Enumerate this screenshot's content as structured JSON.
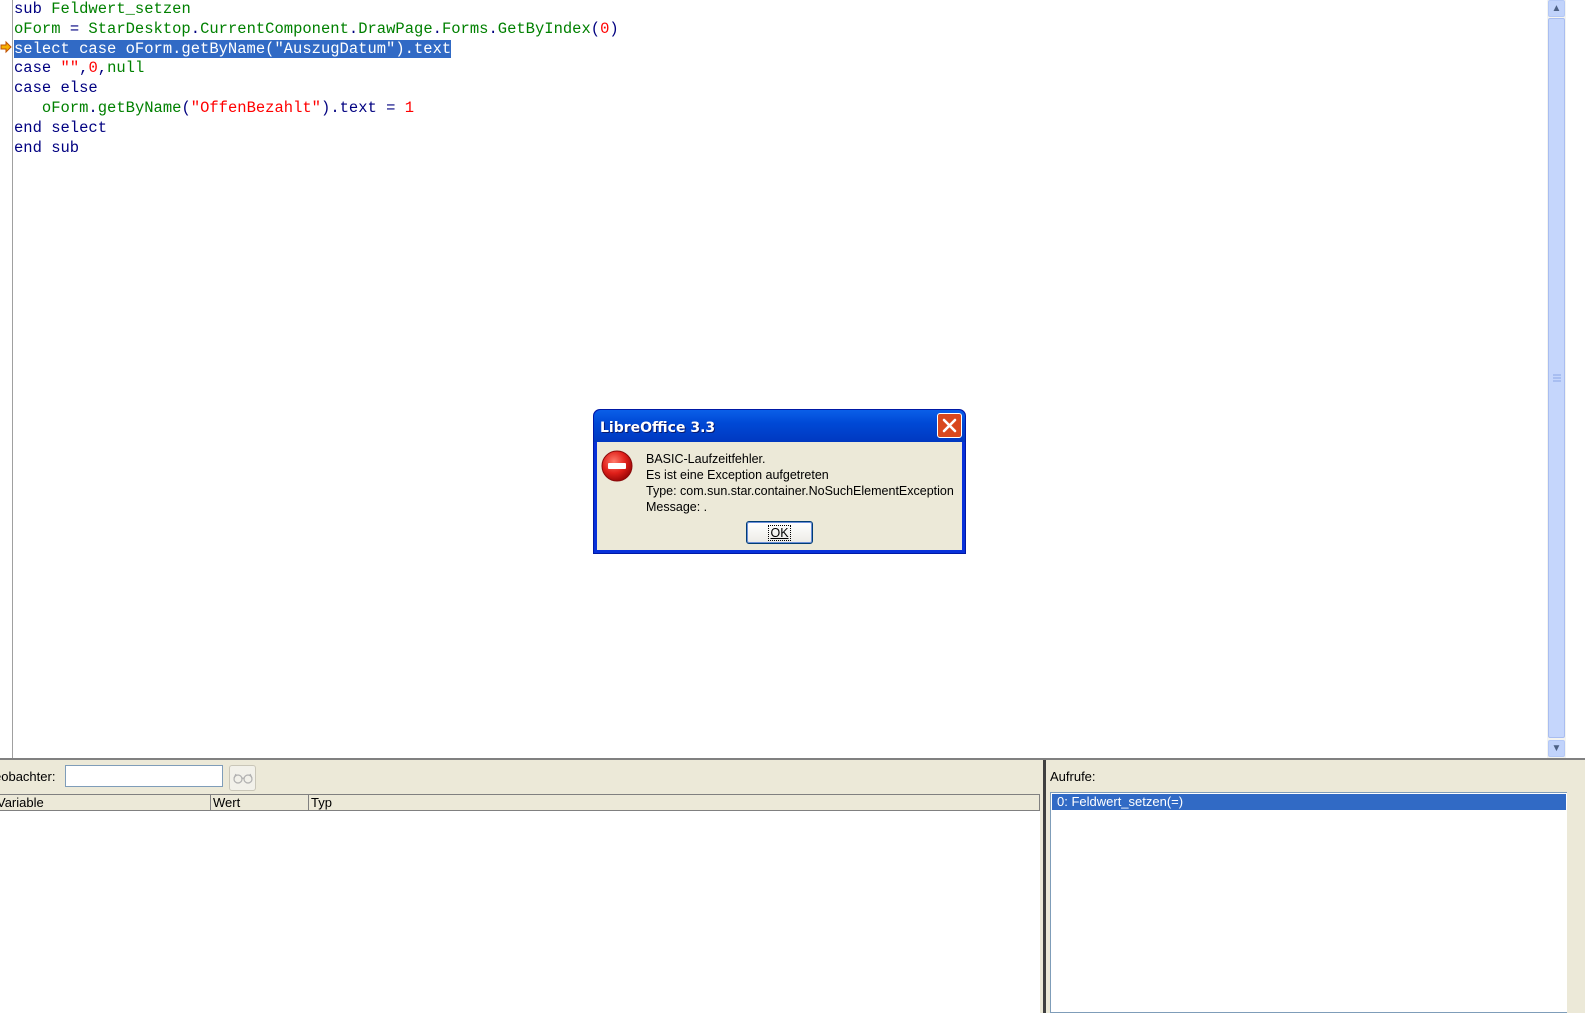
{
  "editor": {
    "lines": [
      [
        {
          "t": "sub ",
          "c": "kw"
        },
        {
          "t": "Feldwert_setzen",
          "c": "id"
        }
      ],
      [
        {
          "t": "oForm",
          "c": "id"
        },
        {
          "t": " = ",
          "c": "op"
        },
        {
          "t": "StarDesktop",
          "c": "id"
        },
        {
          "t": ".",
          "c": "op"
        },
        {
          "t": "CurrentComponent",
          "c": "id"
        },
        {
          "t": ".",
          "c": "op"
        },
        {
          "t": "DrawPage",
          "c": "id"
        },
        {
          "t": ".",
          "c": "op"
        },
        {
          "t": "Forms",
          "c": "id"
        },
        {
          "t": ".",
          "c": "op"
        },
        {
          "t": "GetByIndex",
          "c": "id"
        },
        {
          "t": "(",
          "c": "op"
        },
        {
          "t": "0",
          "c": "num"
        },
        {
          "t": ")",
          "c": "op"
        }
      ],
      [
        {
          "t": "select case oForm.getByName(\"AuszugDatum\").text",
          "c": "hl"
        }
      ],
      [
        {
          "t": "case ",
          "c": "kw"
        },
        {
          "t": "\"\"",
          "c": "str"
        },
        {
          "t": ",",
          "c": "op"
        },
        {
          "t": "0",
          "c": "num"
        },
        {
          "t": ",",
          "c": "op"
        },
        {
          "t": "null",
          "c": "id"
        }
      ],
      [
        {
          "t": "case else",
          "c": "kw"
        }
      ],
      [
        {
          "t": "   ",
          "c": "kw"
        },
        {
          "t": "oForm",
          "c": "id"
        },
        {
          "t": ".",
          "c": "op"
        },
        {
          "t": "getByName",
          "c": "id"
        },
        {
          "t": "(",
          "c": "op"
        },
        {
          "t": "\"OffenBezahlt\"",
          "c": "str"
        },
        {
          "t": ")",
          "c": "op"
        },
        {
          "t": ".text = ",
          "c": "kw"
        },
        {
          "t": "1",
          "c": "num"
        }
      ],
      [
        {
          "t": "end select",
          "c": "kw"
        }
      ],
      [
        {
          "t": "end sub",
          "c": "kw"
        }
      ]
    ]
  },
  "watch": {
    "label": "eobachter:",
    "input_value": "",
    "columns": [
      "Variable",
      "Wert",
      "Typ"
    ]
  },
  "calls": {
    "label": "Aufrufe:",
    "items": [
      "0: Feldwert_setzen(=)"
    ]
  },
  "dialog": {
    "title": "LibreOffice 3.3",
    "message_lines": [
      "BASIC-Laufzeitfehler.",
      "Es ist eine Exception aufgetreten",
      "Type: com.sun.star.container.NoSuchElementException",
      "Message: ."
    ],
    "ok_label": "OK"
  },
  "icons": {
    "breakpoint_arrow": "current-line-arrow-icon",
    "error": "error-stop-icon",
    "close": "close-icon",
    "watch_glasses": "glasses-icon"
  },
  "colors": {
    "selection": "#316ac5",
    "keyword": "#000080",
    "identifier": "#008000",
    "literal": "#ff0000",
    "titlebar": "#0049d6"
  }
}
